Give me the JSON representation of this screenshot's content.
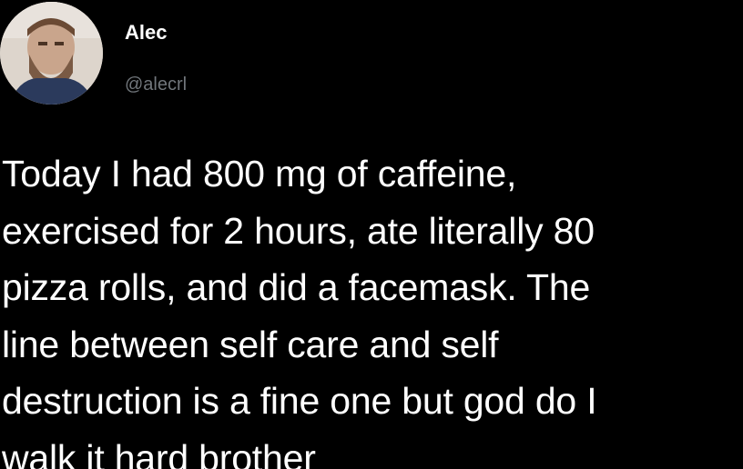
{
  "tweet": {
    "author": {
      "display_name": "Alec",
      "handle": "@alecrl",
      "avatar_icon": "user-avatar-photo"
    },
    "text_lines": [
      "Today I had 800 mg of caffeine,",
      "exercised for 2 hours, ate literally 80",
      "pizza rolls, and did a facemask. The",
      "line between self care and self",
      "destruction is a fine one but god do I",
      "walk it hard brother"
    ]
  },
  "colors": {
    "background": "#000000",
    "text_primary": "#ffffff",
    "text_secondary": "#71767b"
  }
}
